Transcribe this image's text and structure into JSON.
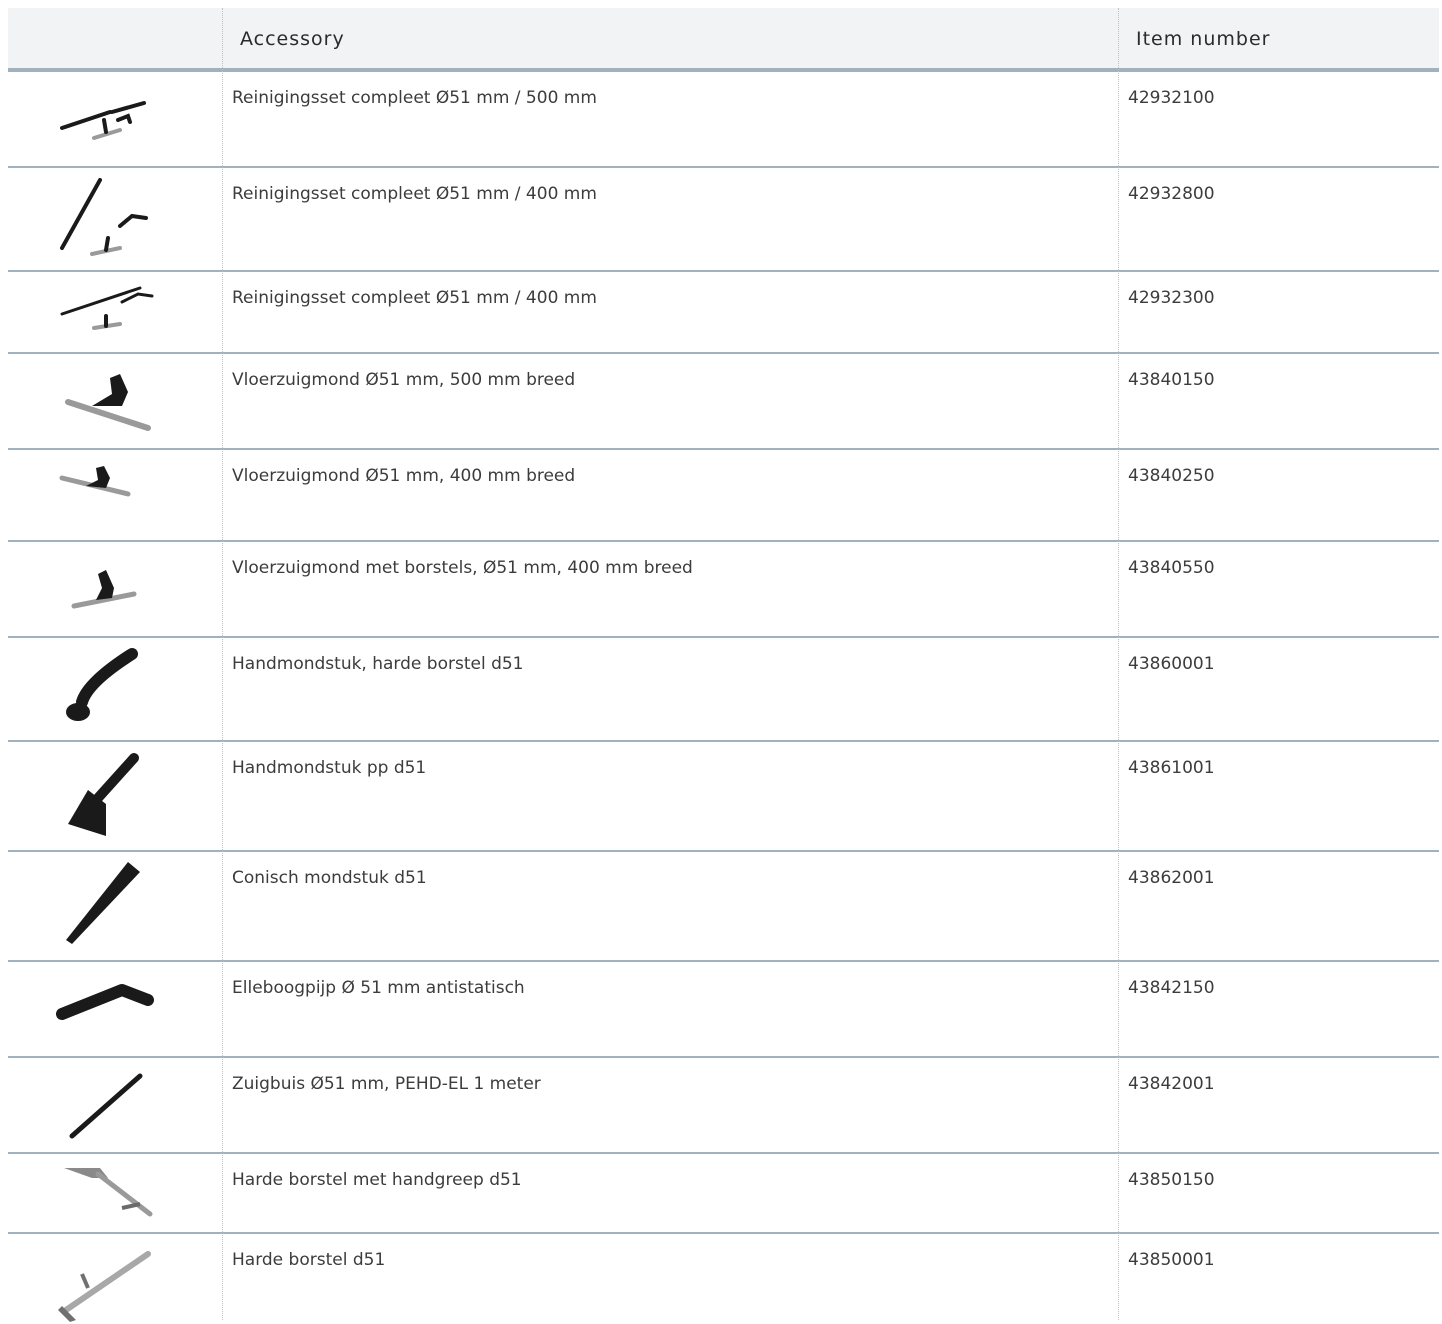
{
  "table": {
    "headers": {
      "image": "",
      "accessory": "Accessory",
      "item_number": "Item number"
    },
    "rows": [
      {
        "description": "Reinigingsset compleet Ø51 mm / 500 mm",
        "item_number": "42932100",
        "icon": "cleaning-set-icon"
      },
      {
        "description": "Reinigingsset compleet Ø51 mm / 400 mm",
        "item_number": "42932800",
        "icon": "cleaning-set-icon"
      },
      {
        "description": "Reinigingsset compleet Ø51 mm / 400 mm",
        "item_number": "42932300",
        "icon": "cleaning-set-icon"
      },
      {
        "description": "Vloerzuigmond Ø51 mm, 500 mm breed",
        "item_number": "43840150",
        "icon": "floor-nozzle-icon"
      },
      {
        "description": "Vloerzuigmond Ø51 mm, 400 mm breed",
        "item_number": "43840250",
        "icon": "floor-nozzle-icon"
      },
      {
        "description": "Vloerzuigmond met borstels, Ø51 mm, 400 mm breed",
        "item_number": "43840550",
        "icon": "floor-nozzle-brush-icon"
      },
      {
        "description": "Handmondstuk, harde borstel d51",
        "item_number": "43860001",
        "icon": "hand-nozzle-brush-icon"
      },
      {
        "description": "Handmondstuk pp d51",
        "item_number": "43861001",
        "icon": "hand-nozzle-icon"
      },
      {
        "description": "Conisch mondstuk d51",
        "item_number": "43862001",
        "icon": "conical-nozzle-icon"
      },
      {
        "description": "Elleboogpijp Ø 51 mm antistatisch",
        "item_number": "43842150",
        "icon": "elbow-pipe-icon"
      },
      {
        "description": "Zuigbuis Ø51 mm, PEHD-EL 1 meter",
        "item_number": "43842001",
        "icon": "suction-tube-icon"
      },
      {
        "description": "Harde borstel met handgreep d51",
        "item_number": "43850150",
        "icon": "squeegee-handle-icon"
      },
      {
        "description": "Harde borstel d51",
        "item_number": "43850001",
        "icon": "squeegee-icon"
      }
    ]
  }
}
